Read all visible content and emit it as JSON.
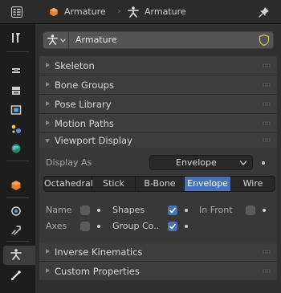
{
  "header": {
    "crumb_object": "Armature",
    "crumb_data": "Armature"
  },
  "datablock": {
    "name": "Armature"
  },
  "sections": {
    "skeleton": "Skeleton",
    "bone_groups": "Bone Groups",
    "pose_library": "Pose Library",
    "motion_paths": "Motion Paths",
    "viewport_display": "Viewport Display",
    "inverse_kinematics": "Inverse Kinematics",
    "custom_properties": "Custom Properties"
  },
  "viewport_display": {
    "display_as_label": "Display As",
    "display_as_value": "Envelope",
    "display_options": [
      "Octahedral",
      "Stick",
      "B-Bone",
      "Envelope",
      "Wire"
    ],
    "selected_option": "Envelope",
    "checkboxes": {
      "name": {
        "label": "Name",
        "checked": false
      },
      "shapes": {
        "label": "Shapes",
        "checked": true
      },
      "in_front": {
        "label": "In Front",
        "checked": false
      },
      "axes": {
        "label": "Axes",
        "checked": false
      },
      "group_colors": {
        "label": "Group Co..",
        "checked": true
      }
    }
  },
  "colors": {
    "accent": "#4772b3",
    "panel": "#303030",
    "section_header": "#3d3d3d",
    "object_orange": "#e8802b"
  },
  "icons": {
    "tabs": [
      "editor-type-icon",
      "tool-icon",
      "render-icon",
      "output-icon",
      "view-layer-icon",
      "scene-icon",
      "world-icon",
      "object-icon",
      "modifier-icon",
      "particles-icon",
      "physics-icon",
      "constraints-icon",
      "armature-data-icon",
      "bone-icon"
    ],
    "header": [
      "object-icon",
      "armature-data-icon",
      "pin-icon"
    ]
  }
}
